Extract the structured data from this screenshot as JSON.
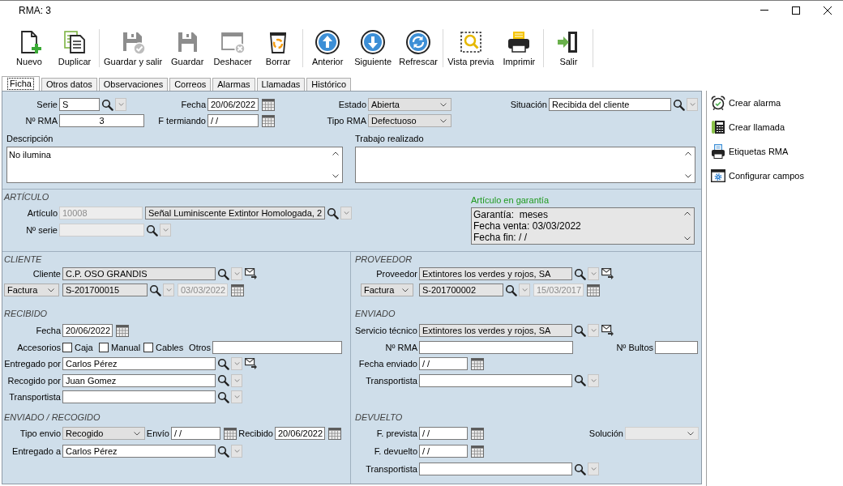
{
  "window": {
    "title": "RMA: 3"
  },
  "toolbar": {
    "groups": [
      [
        {
          "label": "Nuevo",
          "disabled": false
        },
        {
          "label": "Duplicar",
          "disabled": false
        }
      ],
      [
        {
          "label": "Guardar y salir",
          "disabled": true
        },
        {
          "label": "Guardar",
          "disabled": true
        },
        {
          "label": "Deshacer",
          "disabled": true
        },
        {
          "label": "Borrar",
          "disabled": false
        }
      ],
      [
        {
          "label": "Anterior",
          "disabled": false
        },
        {
          "label": "Siguiente",
          "disabled": false
        },
        {
          "label": "Refrescar",
          "disabled": false
        }
      ],
      [
        {
          "label": "Vista previa",
          "disabled": false
        },
        {
          "label": "Imprimir",
          "disabled": false
        }
      ],
      [
        {
          "label": "Salir",
          "disabled": false
        }
      ]
    ]
  },
  "tabs": [
    {
      "label": "Ficha",
      "selected": true
    },
    {
      "label": "Otros datos",
      "selected": false
    },
    {
      "label": "Observaciones",
      "selected": false
    },
    {
      "label": "Correos",
      "selected": false
    },
    {
      "label": "Alarmas",
      "selected": false
    },
    {
      "label": "Llamadas",
      "selected": false
    },
    {
      "label": "Histórico",
      "selected": false
    }
  ],
  "form": {
    "header": {
      "rows": [
        [
          {
            "kind": "lookup",
            "label": "Serie",
            "value": "S",
            "readonly": false,
            "disabled": false
          },
          {
            "kind": "date",
            "label": "Fecha",
            "value": "20/06/2022",
            "readonly": false,
            "disabled": false
          },
          {
            "kind": "select",
            "label": "Estado",
            "value": "Abierta",
            "disabled": false
          },
          {
            "kind": "lookup",
            "label": "Situación",
            "value": "Recibida del cliente",
            "readonly": false,
            "disabled": false
          }
        ],
        [
          {
            "kind": "number",
            "label": "Nº RMA",
            "value": "3",
            "readonly": false,
            "disabled": false
          },
          {
            "kind": "date",
            "label": "F termiando",
            "value": "/ /",
            "readonly": false,
            "disabled": false
          },
          {
            "kind": "select",
            "label": "Tipo RMA",
            "value": "Defectuoso",
            "disabled": false
          }
        ]
      ],
      "memos": [
        {
          "label": "Descripción",
          "value": "No ilumina"
        },
        {
          "label": "Trabajo realizado"
        }
      ]
    },
    "article": {
      "title": "ARTÍCULO",
      "rows": [
        [
          {
            "kind": "text",
            "label": "Artículo",
            "value": "10008",
            "readonly": false,
            "disabled": true
          },
          {
            "kind": "lookup",
            "value": "Señal Luminiscente Extintor Homologada, 2",
            "readonly": true,
            "disabled": false
          }
        ],
        [
          {
            "kind": "lookup",
            "label": "Nº serie",
            "readonly": false,
            "disabled": true
          }
        ]
      ],
      "warranty": {
        "label": "Artículo en garantía",
        "lines": [
          "Garantía:  meses",
          "Fecha venta: 03/03/2022",
          "Fecha fin: / /"
        ]
      }
    },
    "columns": [
      [
        {
          "title": "CLIENTE",
          "rows": [
            [
              {
                "kind": "contact",
                "label": "Cliente",
                "value": "C.P. OSO GRANDIS",
                "readonly": true,
                "disabled": false
              }
            ],
            [
              {
                "kind": "select",
                "value": "Factura",
                "disabled": false
              },
              {
                "kind": "lookup",
                "value": "S-201700015",
                "readonly": true,
                "disabled": false
              },
              {
                "kind": "date",
                "value": "03/03/2022",
                "readonly": false,
                "disabled": true
              }
            ]
          ]
        },
        {
          "title": "RECIBIDO",
          "rows": [
            [
              {
                "kind": "date",
                "label": "Fecha",
                "value": "20/06/2022",
                "readonly": false,
                "disabled": false
              }
            ],
            [
              {
                "kind": "caption",
                "label": "Accesorios"
              },
              {
                "kind": "checkbox",
                "label": "Caja",
                "checked": false
              },
              {
                "kind": "checkbox",
                "label": "Manual",
                "checked": false
              },
              {
                "kind": "checkbox",
                "label": "Cables",
                "checked": false
              },
              {
                "kind": "text",
                "label": "Otros",
                "readonly": false,
                "disabled": false
              }
            ],
            [
              {
                "kind": "contact",
                "label": "Entregado por",
                "value": "Carlos Pérez",
                "readonly": false,
                "disabled": false
              }
            ],
            [
              {
                "kind": "lookup",
                "label": "Recogido por",
                "value": "Juan Gomez",
                "readonly": false,
                "disabled": false
              }
            ],
            [
              {
                "kind": "lookup",
                "label": "Transportista",
                "readonly": false,
                "disabled": false
              }
            ]
          ]
        },
        {
          "title": "ENVIADO / RECOGIDO",
          "rows": [
            [
              {
                "kind": "select",
                "label": "Tipo envio",
                "value": "Recogido",
                "disabled": false
              },
              {
                "kind": "date",
                "label": "Envío",
                "value": "/ /",
                "readonly": false,
                "disabled": false
              },
              {
                "kind": "date",
                "label": "Recibido",
                "value": "20/06/2022",
                "readonly": false,
                "disabled": false
              }
            ],
            [
              {
                "kind": "lookup",
                "label": "Entregado a",
                "value": "Carlos Pérez",
                "readonly": false,
                "disabled": false
              }
            ]
          ]
        }
      ],
      [
        {
          "title": "PROVEEDOR",
          "rows": [
            [
              {
                "kind": "contact",
                "label": "Proveedor",
                "value": "Extintores los verdes y rojos, SA",
                "readonly": true,
                "disabled": false
              }
            ],
            [
              {
                "kind": "select",
                "value": "Factura",
                "disabled": false
              },
              {
                "kind": "lookup",
                "value": "S-201700002",
                "readonly": true,
                "disabled": false
              },
              {
                "kind": "date",
                "value": "15/03/2017",
                "readonly": false,
                "disabled": true
              }
            ]
          ]
        },
        {
          "title": "ENVIADO",
          "rows": [
            [
              {
                "kind": "contact",
                "label": "Servicio técnico",
                "value": "Extintores los verdes y rojos, SA",
                "readonly": true,
                "disabled": false
              }
            ],
            [
              {
                "kind": "text",
                "label": "Nº RMA",
                "readonly": false,
                "disabled": false
              },
              {
                "kind": "text",
                "label": "Nº Bultos",
                "readonly": false,
                "disabled": false
              }
            ],
            [
              {
                "kind": "date",
                "label": "Fecha enviado",
                "value": "/ /",
                "readonly": false,
                "disabled": false
              }
            ],
            [
              {
                "kind": "lookup",
                "label": "Transportista",
                "readonly": false,
                "disabled": false
              }
            ]
          ]
        },
        {
          "title": "DEVUELTO",
          "rows": [
            [
              {
                "kind": "date",
                "label": "F. prevista",
                "value": "/ /",
                "readonly": false,
                "disabled": false
              },
              {
                "kind": "select",
                "label": "Solución",
                "disabled": true
              }
            ],
            [
              {
                "kind": "date",
                "label": "F. devuelto",
                "value": "/ /",
                "readonly": false,
                "disabled": false
              }
            ],
            [
              {
                "kind": "lookup",
                "label": "Transportista",
                "readonly": false,
                "disabled": false
              }
            ]
          ]
        }
      ]
    ]
  },
  "actions": [
    "Crear alarma",
    "Crear llamada",
    "Etiquetas RMA",
    "Configurar campos"
  ]
}
